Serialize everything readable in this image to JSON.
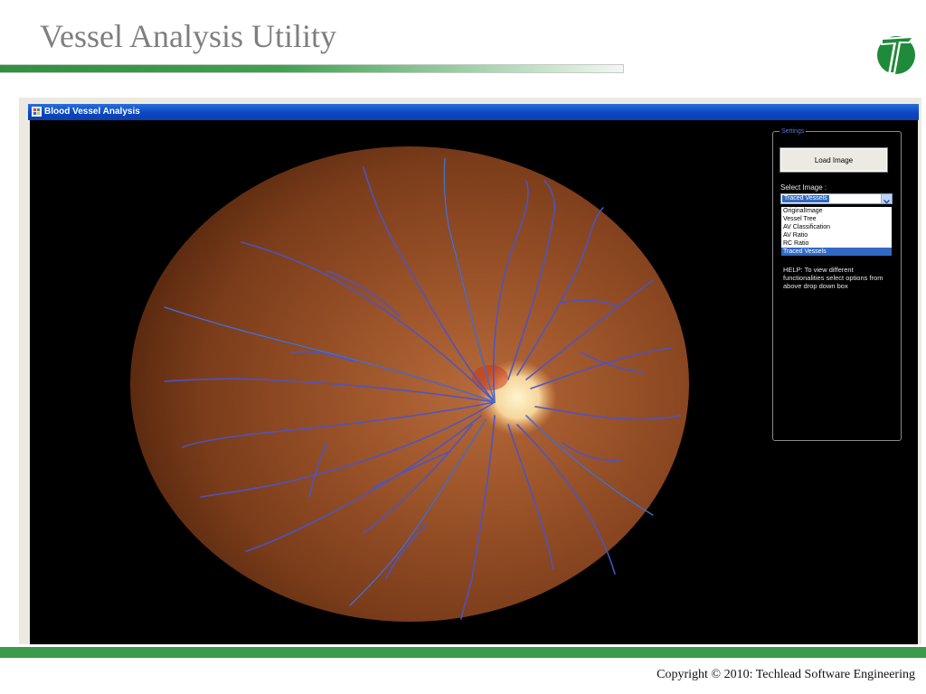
{
  "slide": {
    "title": "Vessel Analysis Utility",
    "copyright": "Copyright © 2010: Techlead Software Engineering",
    "accent_color": "#3a9b4a"
  },
  "window": {
    "title": "Blood Vessel Analysis",
    "icon": "app-window-icon"
  },
  "settings": {
    "group_label": "Settings",
    "load_button_label": "Load Image",
    "select_label": "Select Image :",
    "selected_value": "Traced Vessels",
    "options": [
      {
        "label": "OriginalImage",
        "selected": false
      },
      {
        "label": "Vessel Tree",
        "selected": false
      },
      {
        "label": "AV Classification",
        "selected": false
      },
      {
        "label": "AV Ratio",
        "selected": false
      },
      {
        "label": "RC Ratio",
        "selected": false
      },
      {
        "label": "Traced Vessels",
        "selected": true
      }
    ],
    "help_text": "HELP: To view different functionalities select options from above drop down box"
  },
  "viewer": {
    "image": "retinal-fundus-traced-vessels"
  }
}
